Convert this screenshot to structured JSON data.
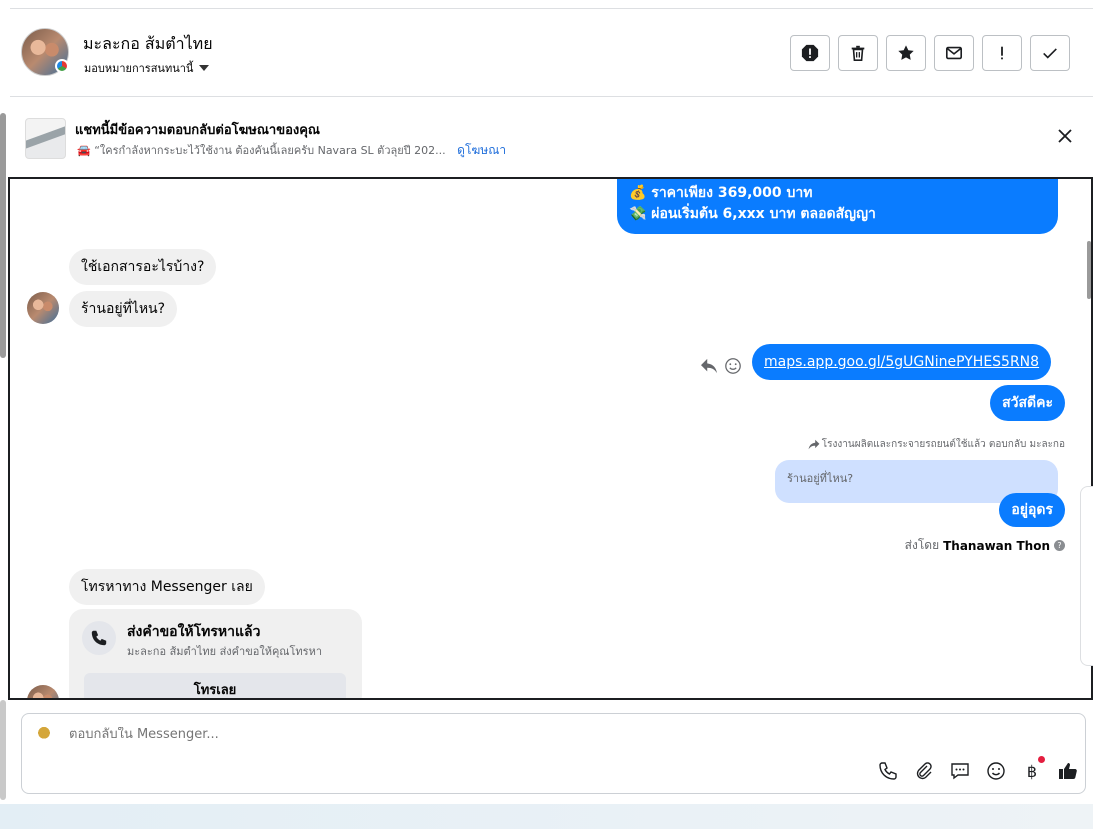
{
  "header": {
    "contact_name": "มะละกอ ส้มตำไทย",
    "assign_label": "มอบหมายการสนทนานี้",
    "actions": [
      "spam-icon",
      "trash-icon",
      "star-icon",
      "mail-icon",
      "exclamation-icon",
      "check-icon"
    ]
  },
  "ad_banner": {
    "title": "แชทนี้มีข้อความตอบกลับต่อโฆษณาของคุณ",
    "subtitle": "🚘 “ใครกำลังหากระบะไว้ใช้งาน ต้องคันนี้เลยครับ Navara SL ตัวลุยปี 202...",
    "link": "ดูโฆษณา"
  },
  "messages": {
    "price_line1": "💰 ราคาเพียง 369,000 บาท",
    "price_line2": "💸 ผ่อนเริ่มต้น 6,xxx บาท ตลอดสัญญา",
    "incoming_1": "ใช้เอกสารอะไรบ้าง?",
    "incoming_2": "ร้านอยู่ที่ไหน?",
    "maps_link": "maps.app.goo.gl/5gUGNinePYHES5RN8",
    "greeting": "สวัสดีคะ",
    "reply_meta": "โรงงานผลิตและกระจายรถยนต์ใช้แล้ว ตอบกลับ มะละกอ",
    "quoted": "ร้านอยู่ที่ไหน?",
    "udon": "อยู่อุดร",
    "sent_by_prefix": "ส่งโดย",
    "sent_by_name": "Thanawan Thon",
    "incoming_3": "โทรหาทาง Messenger เลย",
    "call_title": "ส่งคำขอให้โทรหาแล้ว",
    "call_sub": "มะละกอ ส้มตำไทย ส่งคำขอให้คุณโทรหา",
    "call_button": "โทรเลย"
  },
  "composer": {
    "placeholder": "ตอบกลับใน Messenger..."
  },
  "colors": {
    "outgoing": "#0a7cff",
    "incoming": "#f0f0f0",
    "link": "#216fdb"
  }
}
